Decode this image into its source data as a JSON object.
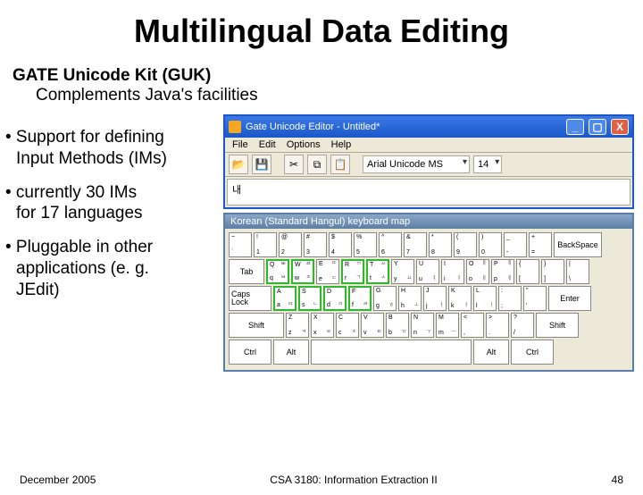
{
  "slide": {
    "title": "Multilingual Data Editing",
    "subtitle1": "GATE Unicode Kit (GUK)",
    "subtitle2": "Complements Java's facilities",
    "bullets": [
      {
        "l1": "• Support for defining",
        "l2": "Input Methods (IMs)"
      },
      {
        "l1": "• currently 30 IMs",
        "l2": "for 17 languages"
      },
      {
        "l1": "• Pluggable in other",
        "l2": "applications (e. g.",
        "l3": "JEdit)"
      }
    ],
    "footer_left": "December 2005",
    "footer_center": "CSA 3180: Information Extraction II",
    "footer_right": "48"
  },
  "editor": {
    "title": "Gate Unicode Editor - Untitled*",
    "menus": [
      "File",
      "Edit",
      "Options",
      "Help"
    ],
    "toolbar_icons": [
      "open-icon",
      "save-icon",
      "cut-icon",
      "copy-icon",
      "paste-icon"
    ],
    "font": "Arial Unicode MS",
    "font_size": "14",
    "content": "내"
  },
  "keyboard": {
    "title": "Korean (Standard Hangul) keyboard map",
    "row1": [
      {
        "tl": "~",
        "bl": "`"
      },
      {
        "tl": "!",
        "tr": "",
        "bl": "1"
      },
      {
        "tl": "@",
        "tr": "",
        "bl": "2"
      },
      {
        "tl": "#",
        "tr": "",
        "bl": "3"
      },
      {
        "tl": "$",
        "tr": "",
        "bl": "4"
      },
      {
        "tl": "%",
        "tr": "",
        "bl": "5"
      },
      {
        "tl": "^",
        "tr": "",
        "bl": "6"
      },
      {
        "tl": "&",
        "tr": "",
        "bl": "7"
      },
      {
        "tl": "*",
        "tr": "",
        "bl": "8"
      },
      {
        "tl": "(",
        "tr": "",
        "bl": "9"
      },
      {
        "tl": ")",
        "tr": "",
        "bl": "0"
      },
      {
        "tl": "_",
        "bl": "-"
      },
      {
        "tl": "+",
        "bl": "="
      }
    ],
    "backspace": "BackSpace",
    "tab": "Tab",
    "row2": [
      {
        "tl": "Q",
        "tr": "ㅃ",
        "bl": "q",
        "br": "ㅂ",
        "hl": true
      },
      {
        "tl": "W",
        "tr": "ㅉ",
        "bl": "w",
        "br": "ㅈ",
        "hl": true
      },
      {
        "tl": "E",
        "tr": "ㄸ",
        "bl": "e",
        "br": "ㄷ"
      },
      {
        "tl": "R",
        "tr": "ㄲ",
        "bl": "r",
        "br": "ㄱ",
        "hl": true
      },
      {
        "tl": "T",
        "tr": "ㅆ",
        "bl": "t",
        "br": "ㅅ",
        "hl": true
      },
      {
        "tl": "Y",
        "tr": "",
        "bl": "y",
        "br": "ㅛ"
      },
      {
        "tl": "U",
        "tr": "",
        "bl": "u",
        "br": "ㅕ"
      },
      {
        "tl": "I",
        "tr": "",
        "bl": "i",
        "br": "ㅑ"
      },
      {
        "tl": "O",
        "tr": "ㅒ",
        "bl": "o",
        "br": "ㅐ"
      },
      {
        "tl": "P",
        "tr": "ㅖ",
        "bl": "p",
        "br": "ㅔ"
      },
      {
        "tl": "{",
        "bl": "["
      },
      {
        "tl": "}",
        "bl": "]"
      },
      {
        "tl": "|",
        "bl": "\\"
      }
    ],
    "caps": "Caps Lock",
    "row3": [
      {
        "tl": "A",
        "tr": "",
        "bl": "a",
        "br": "ㅁ",
        "hl": true
      },
      {
        "tl": "S",
        "tr": "",
        "bl": "s",
        "br": "ㄴ",
        "hl": true
      },
      {
        "tl": "D",
        "tr": "",
        "bl": "d",
        "br": "ㅇ",
        "hl": true
      },
      {
        "tl": "F",
        "tr": "",
        "bl": "f",
        "br": "ㄹ",
        "hl": true
      },
      {
        "tl": "G",
        "tr": "",
        "bl": "g",
        "br": "ㅎ"
      },
      {
        "tl": "H",
        "tr": "",
        "bl": "h",
        "br": "ㅗ"
      },
      {
        "tl": "J",
        "tr": "",
        "bl": "j",
        "br": "ㅓ"
      },
      {
        "tl": "K",
        "tr": "",
        "bl": "k",
        "br": "ㅏ"
      },
      {
        "tl": "L",
        "tr": "",
        "bl": "l",
        "br": "ㅣ"
      },
      {
        "tl": ":",
        "bl": ";"
      },
      {
        "tl": "\"",
        "bl": "'"
      }
    ],
    "enter": "Enter",
    "shift": "Shift",
    "row4": [
      {
        "tl": "Z",
        "tr": "",
        "bl": "z",
        "br": "ㅋ"
      },
      {
        "tl": "X",
        "tr": "",
        "bl": "x",
        "br": "ㅌ"
      },
      {
        "tl": "C",
        "tr": "",
        "bl": "c",
        "br": "ㅊ"
      },
      {
        "tl": "V",
        "tr": "",
        "bl": "v",
        "br": "ㅍ"
      },
      {
        "tl": "B",
        "tr": "",
        "bl": "b",
        "br": "ㅠ"
      },
      {
        "tl": "N",
        "tr": "",
        "bl": "n",
        "br": "ㅜ"
      },
      {
        "tl": "M",
        "tr": "",
        "bl": "m",
        "br": "ㅡ"
      },
      {
        "tl": "<",
        "bl": ","
      },
      {
        "tl": ">",
        "bl": "."
      },
      {
        "tl": "?",
        "bl": "/"
      }
    ],
    "ctrl": "Ctrl",
    "alt": "Alt"
  }
}
